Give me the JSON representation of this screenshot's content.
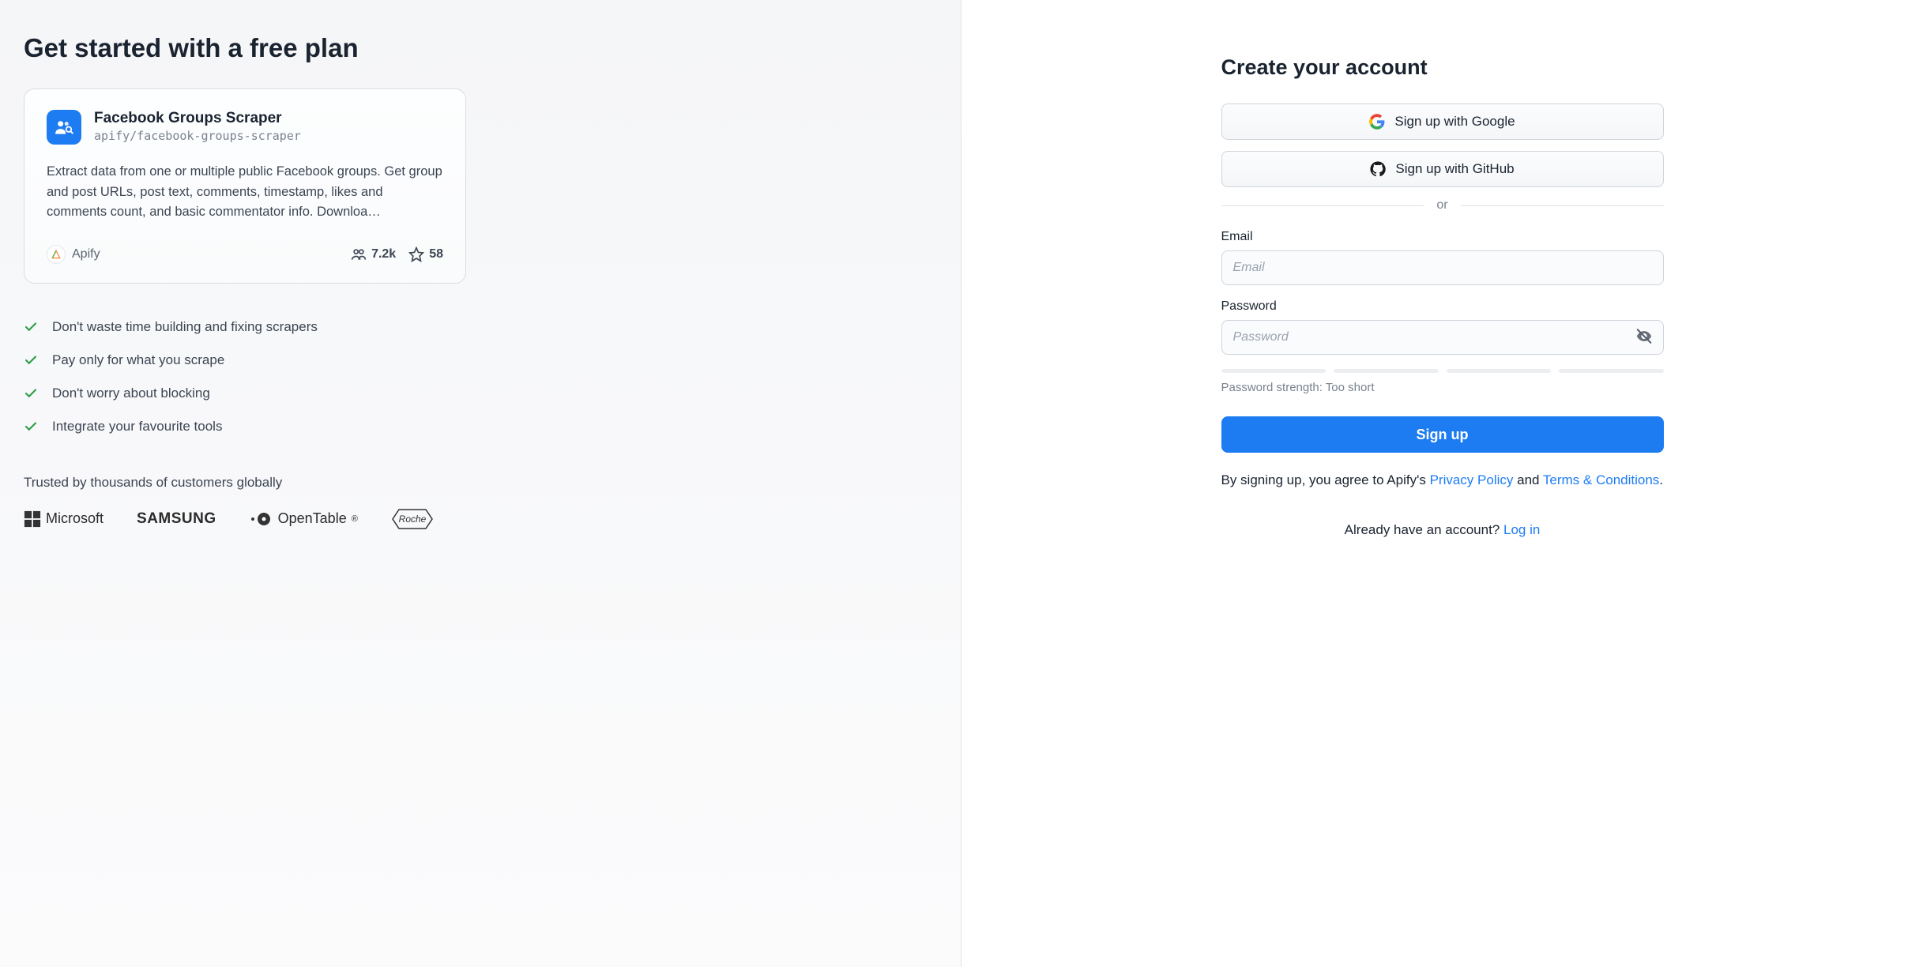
{
  "left": {
    "headline": "Get started with a free plan",
    "card": {
      "title": "Facebook Groups Scraper",
      "slug": "apify/facebook-groups-scraper",
      "description": "Extract data from one or multiple public Facebook groups. Get group and post URLs, post text, comments, timestamp, likes and comments count, and basic commentator info. Downloa…",
      "author": "Apify",
      "users": "7.2k",
      "stars": "58"
    },
    "benefits": [
      "Don't waste time building and fixing scrapers",
      "Pay only for what you scrape",
      "Don't worry about blocking",
      "Integrate your favourite tools"
    ],
    "trusted_heading": "Trusted by thousands of customers globally",
    "logos": [
      "Microsoft",
      "SAMSUNG",
      "OpenTable",
      "Roche"
    ]
  },
  "form": {
    "title": "Create your account",
    "google_label": "Sign up with Google",
    "github_label": "Sign up with GitHub",
    "divider": "or",
    "email_label": "Email",
    "email_placeholder": "Email",
    "password_label": "Password",
    "password_placeholder": "Password",
    "strength_text": "Password strength: Too short",
    "submit_label": "Sign up",
    "legal_prefix": "By signing up, you agree to Apify's ",
    "legal_privacy": "Privacy Policy",
    "legal_and": " and ",
    "legal_terms": "Terms & Conditions",
    "legal_suffix": ".",
    "login_prompt": "Already have an account? ",
    "login_link": "Log in"
  }
}
